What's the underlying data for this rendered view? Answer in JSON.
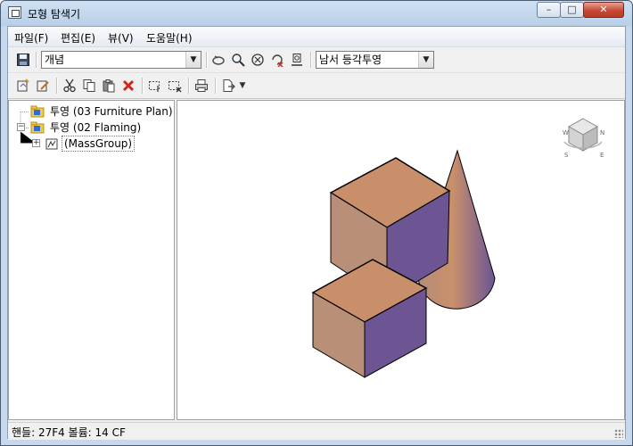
{
  "window": {
    "title": "모형 탐색기",
    "controls": {
      "minimize": "–",
      "maximize": "□",
      "close": "✕"
    }
  },
  "menu": [
    {
      "label": "파일(F)"
    },
    {
      "label": "편집(E)"
    },
    {
      "label": "뷰(V)"
    },
    {
      "label": "도움말(H)"
    }
  ],
  "toolbar": {
    "visual_style_value": "개념",
    "view_value": "남서 등각투영",
    "icons_row1": [
      "save-icon",
      "orbit-icon",
      "zoom-icon",
      "zoom-extents-icon",
      "pan-rotate-icon",
      "camera-icon"
    ],
    "icons_row2": [
      "new-view-icon",
      "edit-view-icon",
      "cut-icon",
      "copy-icon",
      "paste-icon",
      "delete-icon",
      "select-icon",
      "deselect-icon",
      "print-icon",
      "export-icon",
      "dropdown-arrow-icon"
    ]
  },
  "tree": {
    "items": [
      {
        "label": "투영 (03 Furniture Plan)",
        "icon": "folder-view-icon",
        "level": 0,
        "expanded": false
      },
      {
        "label": "투영 (02 Flaming)",
        "icon": "folder-view-icon",
        "level": 0,
        "expanded": true
      },
      {
        "label": "(MassGroup)",
        "icon": "mass-group-icon",
        "level": 1,
        "expanded": false
      }
    ]
  },
  "viewport": {
    "viewcube_labels": [
      "S",
      "W",
      "N",
      "E"
    ],
    "colors": {
      "face_top": "#c98f6a",
      "face_left": "#b98f78",
      "face_right": "#6d5594",
      "edge": "#000000"
    }
  },
  "status": {
    "text": "핸들: 27F4  볼륨: 14 CF"
  }
}
